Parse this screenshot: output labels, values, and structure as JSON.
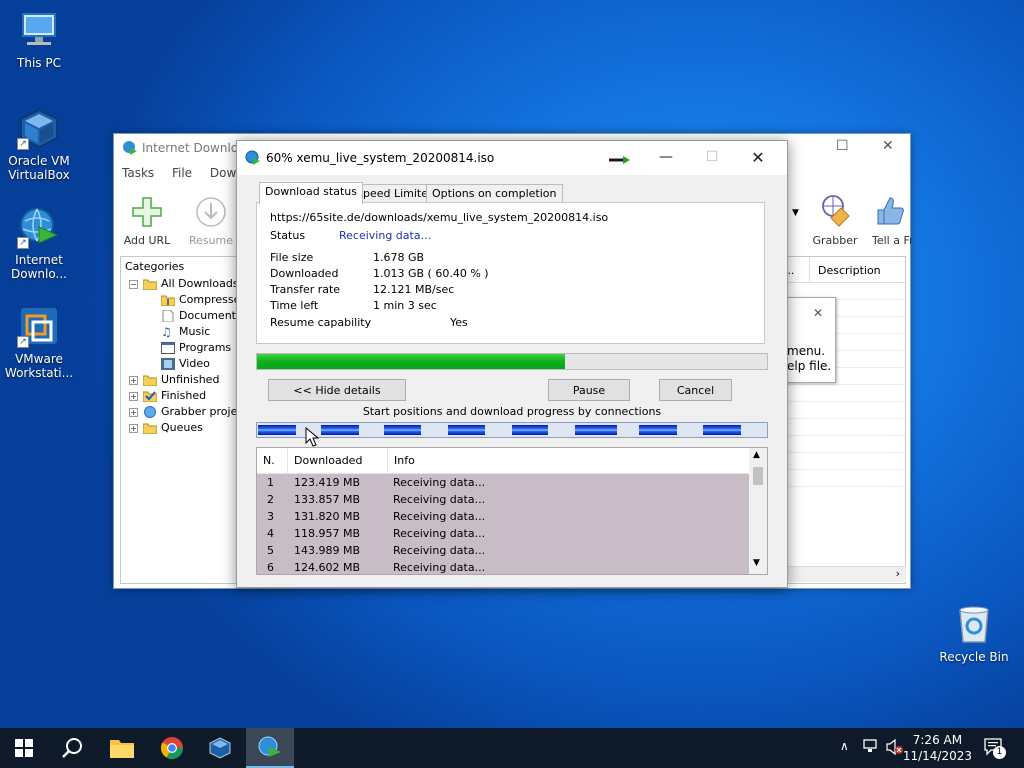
{
  "desktop": {
    "icons": [
      {
        "label": "This PC"
      },
      {
        "label": "Oracle VM VirtualBox"
      },
      {
        "label": "Internet Downlo..."
      },
      {
        "label": "VMware Workstati..."
      },
      {
        "label": "Recycle Bin"
      }
    ]
  },
  "main_window": {
    "title": "Internet Download",
    "menu": [
      "Tasks",
      "File",
      "Downlo"
    ],
    "toolbar": {
      "add_url": "Add URL",
      "resume": "Resume",
      "grabber": "Grabber",
      "tell_friend": "Tell a Fri"
    },
    "categories_header": "Categories",
    "tree": [
      {
        "label": "All Downloads"
      },
      {
        "label": "Compresse"
      },
      {
        "label": "Documents"
      },
      {
        "label": "Music"
      },
      {
        "label": "Programs"
      },
      {
        "label": "Video"
      },
      {
        "label": "Unfinished"
      },
      {
        "label": "Finished"
      },
      {
        "label": "Grabber projec"
      },
      {
        "label": "Queues"
      }
    ],
    "columns": {
      "last_try": "y...",
      "description": "Description"
    }
  },
  "tooltip": {
    "line1": "menu.",
    "line2": "elp file."
  },
  "dialog": {
    "title": "60% xemu_live_system_20200814.iso",
    "tabs": [
      "Download status",
      "Speed Limiter",
      "Options on completion"
    ],
    "url": "https://65site.de/downloads/xemu_live_system_20200814.iso",
    "status_label": "Status",
    "status_value": "Receiving data...",
    "status_color": "#1a32b4",
    "file_size_label": "File size",
    "file_size_value": "1.678  GB",
    "downloaded_label": "Downloaded",
    "downloaded_value": "1.013  GB  ( 60.40 % )",
    "transfer_rate_label": "Transfer rate",
    "transfer_rate_value": "12.121  MB/sec",
    "time_left_label": "Time left",
    "time_left_value": "1 min 3 sec",
    "resume_label": "Resume capability",
    "resume_value": "Yes",
    "progress_percent": 60.4,
    "hide_details": "<< Hide details",
    "pause": "Pause",
    "cancel": "Cancel",
    "connections_caption": "Start positions and download progress by connections",
    "table_headers": [
      "N.",
      "Downloaded",
      "Info"
    ],
    "connections": [
      {
        "n": "1",
        "downloaded": "123.419  MB",
        "info": "Receiving data..."
      },
      {
        "n": "2",
        "downloaded": "133.857  MB",
        "info": "Receiving data..."
      },
      {
        "n": "3",
        "downloaded": "131.820  MB",
        "info": "Receiving data..."
      },
      {
        "n": "4",
        "downloaded": "118.957  MB",
        "info": "Receiving data..."
      },
      {
        "n": "5",
        "downloaded": "143.989  MB",
        "info": "Receiving data..."
      },
      {
        "n": "6",
        "downloaded": "124.602  MB",
        "info": "Receiving data..."
      }
    ]
  },
  "taskbar": {
    "time": "7:26 AM",
    "date": "11/14/2023",
    "notification_count": "1",
    "accent_color": "#76b9ed"
  }
}
